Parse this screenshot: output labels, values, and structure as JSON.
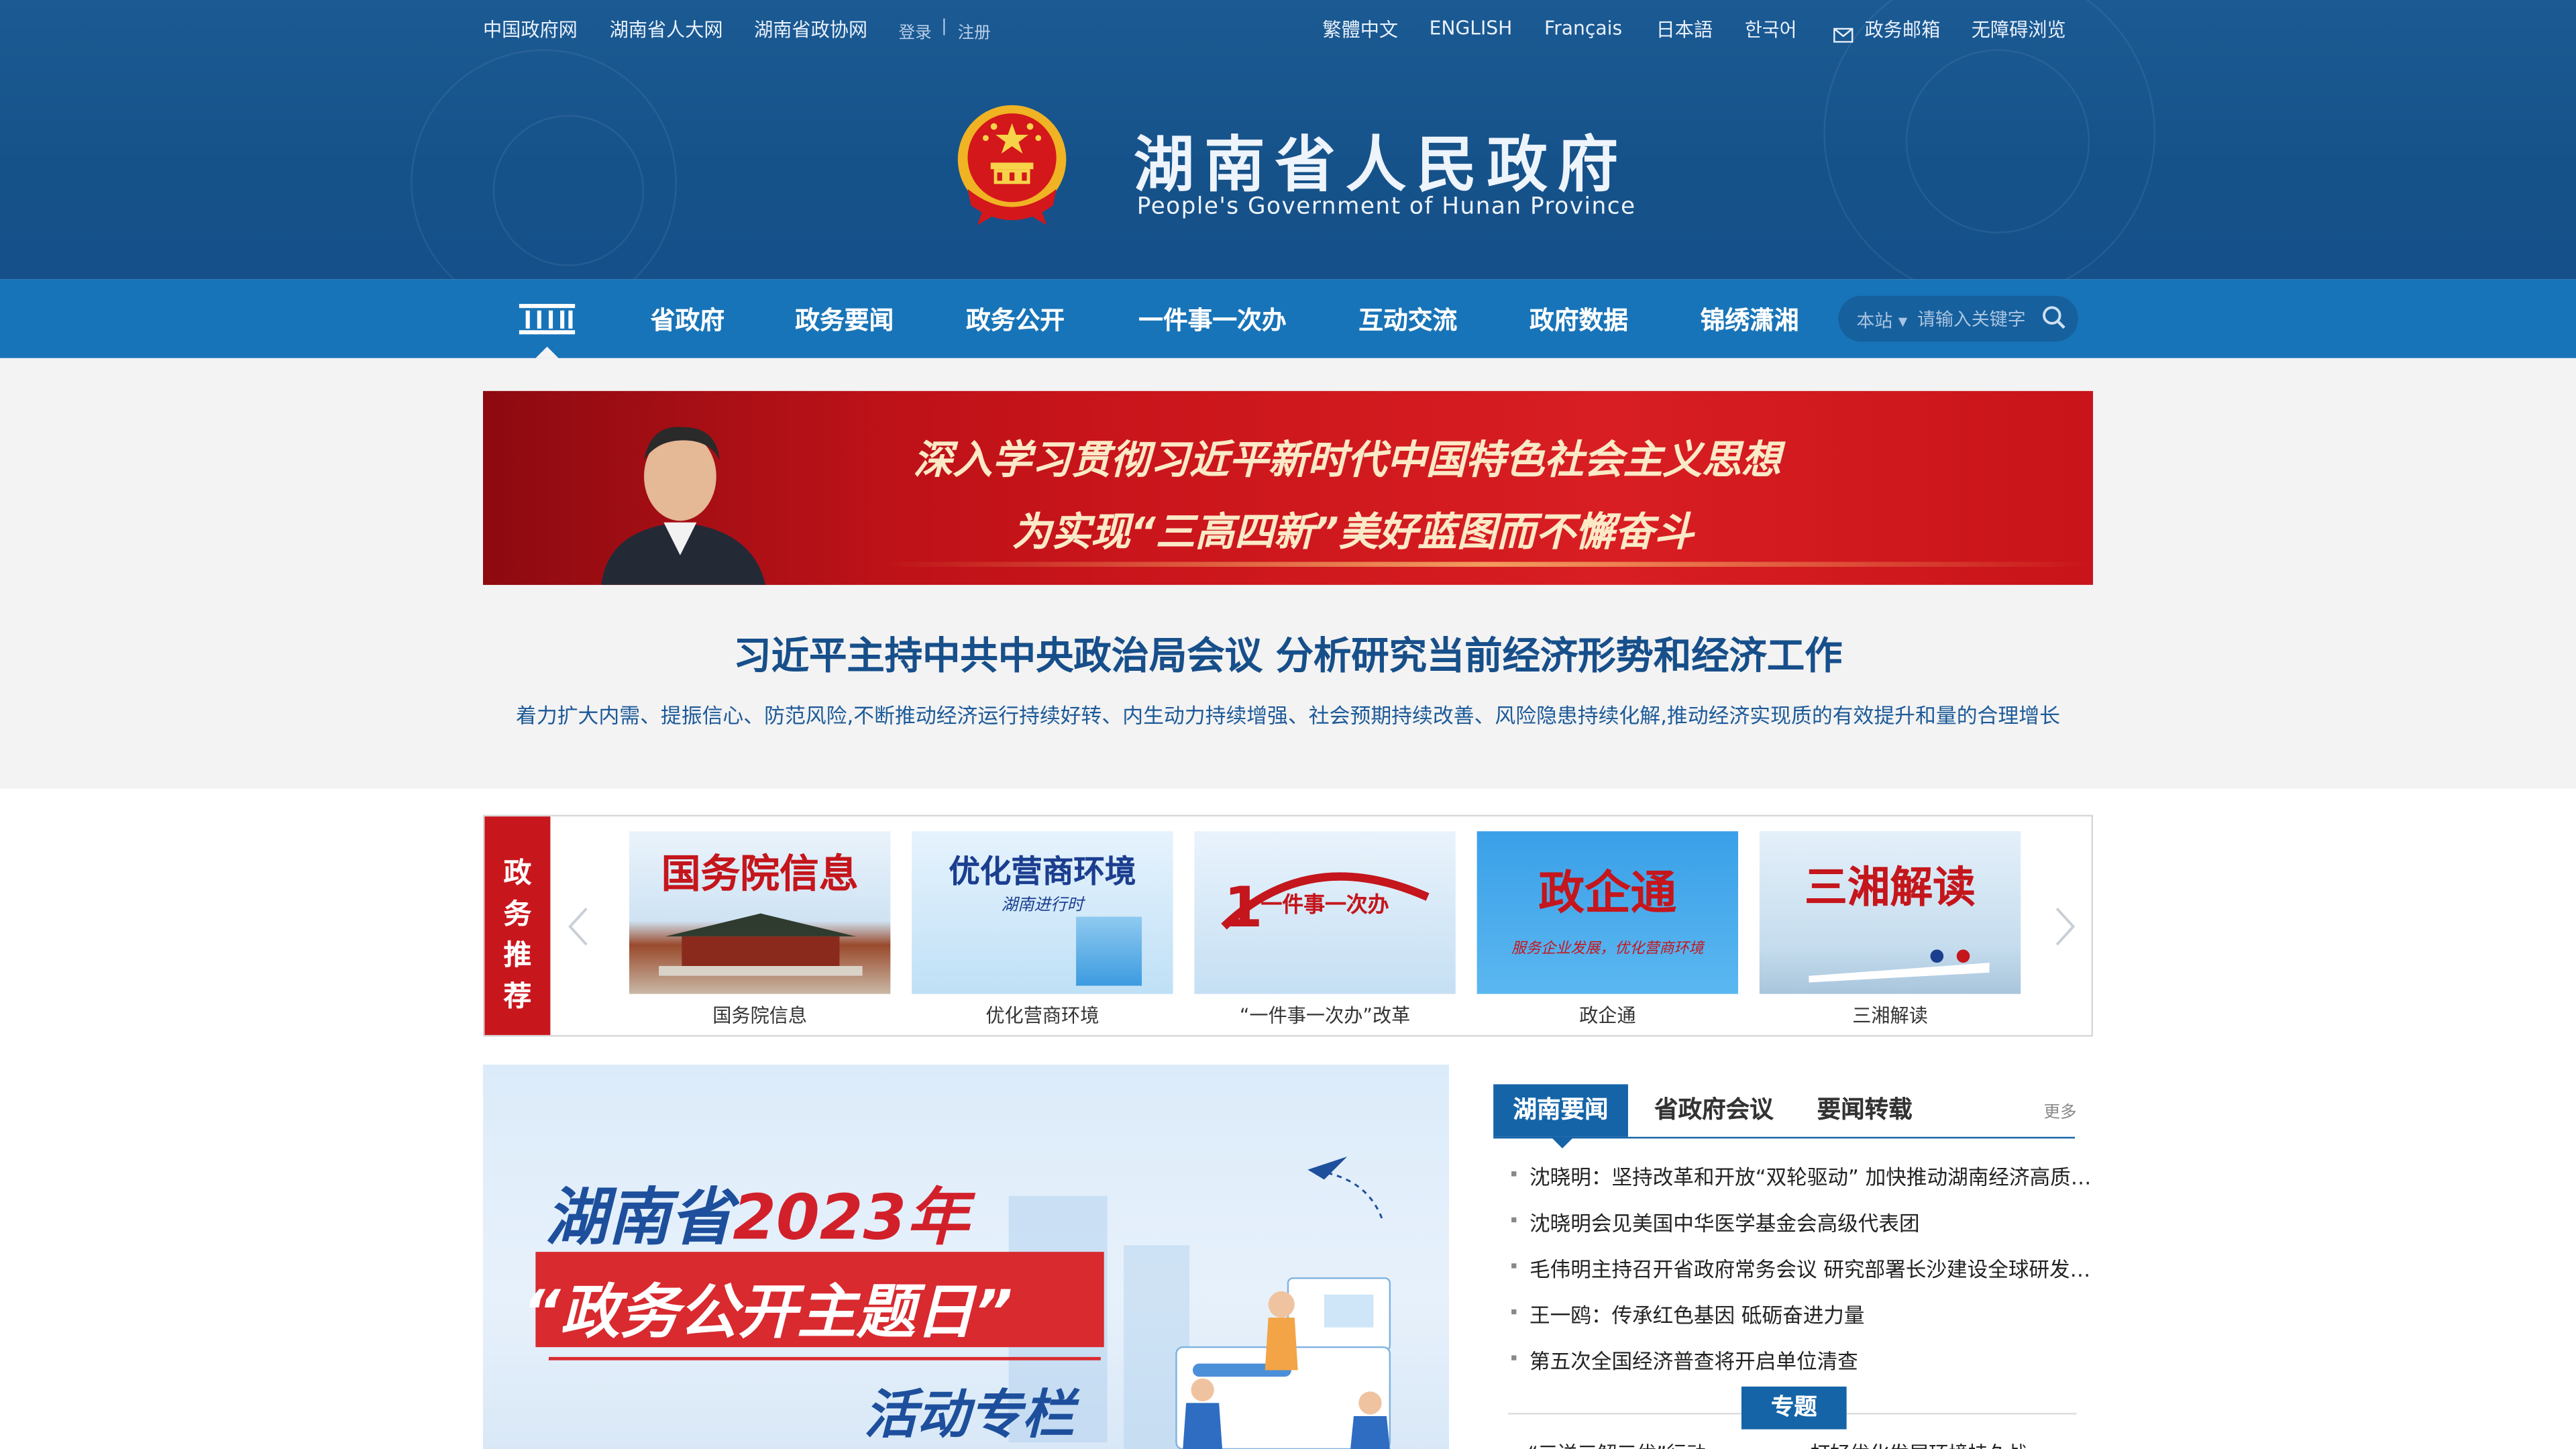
{
  "top_bar": {
    "left_links": [
      "中国政府网",
      "湖南省人大网",
      "湖南省政协网"
    ],
    "login": "登录",
    "separator": "|",
    "register": "注册",
    "right_links": [
      "繁體中文",
      "ENGLISH",
      "Français",
      "日本語",
      "한국어"
    ],
    "mailbox": "政务邮箱",
    "accessibility": "无障碍浏览"
  },
  "brand": {
    "title": "湖南省人民政府",
    "subtitle": "People's Government of Hunan Province"
  },
  "nav": {
    "home_icon": "government-building-icon",
    "items": [
      "省政府",
      "政务要闻",
      "政务公开",
      "一件事一次办",
      "互动交流",
      "政府数据",
      "锦绣潇湘"
    ],
    "search_scope": "本站",
    "search_placeholder": "请输入关键字"
  },
  "banner": {
    "line1": "深入学习贯彻习近平新时代中国特色社会主义思想",
    "line2": "为实现“三高四新”美好蓝图而不懈奋斗"
  },
  "headline": {
    "title": "习近平主持中共中央政治局会议 分析研究当前经济形势和经济工作",
    "summary": "着力扩大内需、提振信心、防范风险,不断推动经济运行持续好转、内生动力持续增强、社会预期持续改善、风险隐患持续化解,推动经济实现质的有效提升和量的合理增长"
  },
  "recommend": {
    "label_chars": [
      "政",
      "务",
      "推",
      "荐"
    ],
    "cards": [
      {
        "image_title": "国务院信息",
        "caption": "国务院信息",
        "color": "#c4161c"
      },
      {
        "image_title": "优化营商环境",
        "image_sub": "湖南进行时",
        "caption": "优化营商环境",
        "color": "#1b3e8f"
      },
      {
        "image_title": "一件事一次办",
        "caption": "“一件事一次办”改革",
        "color": "#c4161c"
      },
      {
        "image_title": "政企通",
        "image_sub": "服务企业发展，优化营商环境",
        "caption": "政企通",
        "color": "#c4161c"
      },
      {
        "image_title": "三湘解读",
        "caption": "三湘解读",
        "color": "#c4161c"
      }
    ]
  },
  "promo": {
    "line1_prefix": "湖南省",
    "line1_year": "2023年",
    "line2": "“政务公开主题日”",
    "line3": "活动专栏"
  },
  "news_tabs": {
    "tabs": [
      "湖南要闻",
      "省政府会议",
      "要闻转载"
    ],
    "more": "更多",
    "items": [
      "沈晓明：坚持改革和开放“双轮驱动” 加快推动湖南经济高质量发展",
      "沈晓明会见美国中华医学基金会高级代表团",
      "毛伟明主持召开省政府常务会议 研究部署长沙建设全球研发中心城市",
      "王一鸥：传承红色基因 砥砺奋进力量",
      "第五次全国经济普查将开启单位清查"
    ],
    "special_label": "专题",
    "special_links": [
      "“三送三解三优”行动",
      "打好优化发展环境持久战"
    ]
  },
  "colors": {
    "header_blue": "#1b5a93",
    "nav_blue": "#1874b8",
    "accent_red": "#c8161d",
    "headline_blue": "#174f8a"
  }
}
